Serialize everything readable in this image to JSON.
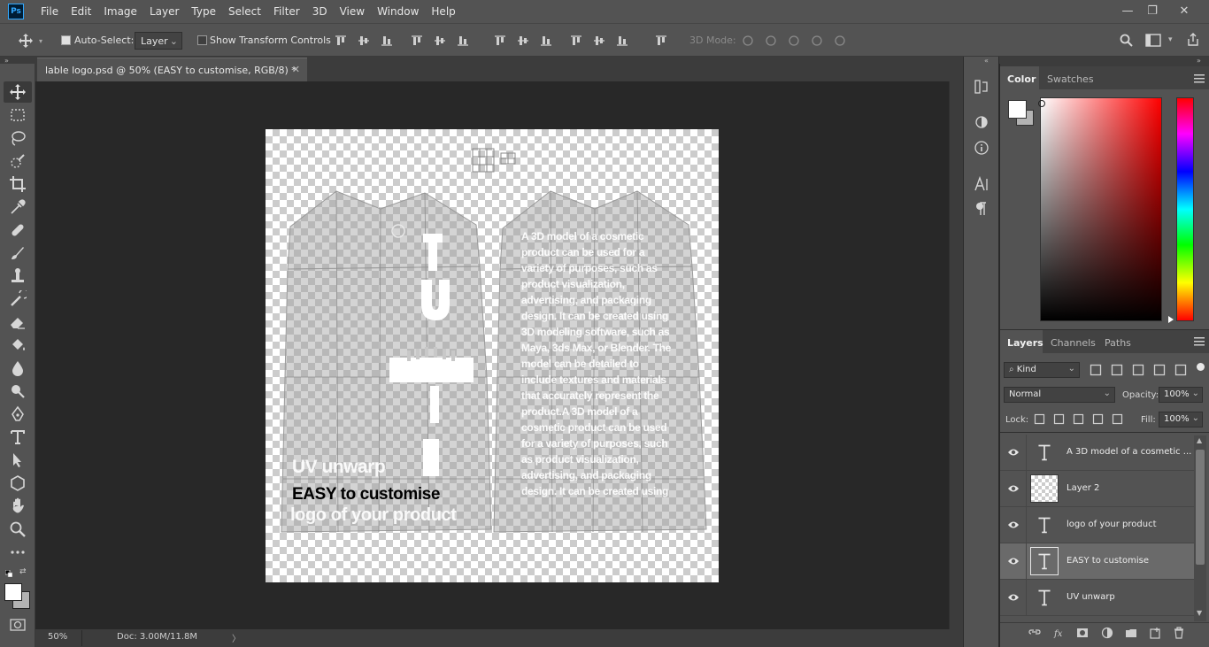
{
  "app": {
    "logo": "Ps"
  },
  "menu": [
    "File",
    "Edit",
    "Image",
    "Layer",
    "Type",
    "Select",
    "Filter",
    "3D",
    "View",
    "Window",
    "Help"
  ],
  "window_controls": {
    "minimize": "—",
    "restore": "❐",
    "close": "✕"
  },
  "options": {
    "auto_select_label": "Auto-Select:",
    "auto_select_value": "Layer",
    "show_transform_label": "Show Transform Controls",
    "mode_3d_label": "3D Mode:"
  },
  "document": {
    "tab_title": "lable  logo.psd @ 50% (EASY to customise, RGB/8) *",
    "close": "✕",
    "zoom": "50%",
    "doc_info": "Doc: 3.00M/11.8M",
    "canvas_texts": {
      "uv_unwarp": "UV unwarp",
      "easy": "EASY to customise",
      "logo": "logo of your product",
      "paragraph": "A 3D model of a cosmetic product can be used for a variety of purposes, such as product visualization, advertising, and packaging design. It can be created using 3D modeling software, such as Maya, 3ds Max, or Blender. The model can be detailed to include textures and materials that accurately represent the product.A 3D model of a cosmetic product can be used for a variety of purposes, such as product visualization, advertising, and packaging design. It can be created using"
    }
  },
  "color_panel": {
    "tabs": [
      "Color",
      "Swatches"
    ],
    "active": "Color",
    "foreground": "#ffffff",
    "background": "#b3b3b3"
  },
  "layers_panel": {
    "tabs": [
      "Layers",
      "Channels",
      "Paths"
    ],
    "kind_label": "Kind",
    "blend_mode": "Normal",
    "opacity_label": "Opacity:",
    "opacity": "100%",
    "lock_label": "Lock:",
    "fill_label": "Fill:",
    "fill": "100%",
    "layers": [
      {
        "name": "A 3D model of a cosmetic ...",
        "type": "text",
        "selected": false
      },
      {
        "name": "Layer 2",
        "type": "raster",
        "selected": false
      },
      {
        "name": "logo of your product",
        "type": "text",
        "selected": false
      },
      {
        "name": "EASY to customise",
        "type": "text",
        "selected": true
      },
      {
        "name": "UV unwarp",
        "type": "text",
        "selected": false
      }
    ],
    "footer_icons": [
      "link-icon",
      "fx-icon",
      "mask-icon",
      "adjustment-icon",
      "group-icon",
      "new-layer-icon",
      "trash-icon"
    ]
  },
  "toolbar_icons": [
    "move-icon",
    "marquee-icon",
    "lasso-icon",
    "quick-select-icon",
    "crop-icon",
    "eyedropper-icon",
    "healing-icon",
    "brush-icon",
    "stamp-icon",
    "history-brush-icon",
    "eraser-icon",
    "paint-bucket-icon",
    "blur-icon",
    "dodge-icon",
    "pen-icon",
    "type-icon",
    "path-select-icon",
    "shape-icon",
    "hand-icon",
    "zoom-icon",
    "more-icon"
  ]
}
